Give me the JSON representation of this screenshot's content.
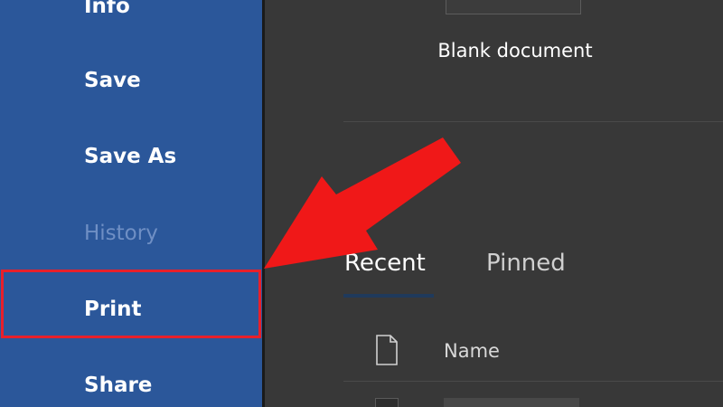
{
  "nav": {
    "items": [
      {
        "key": "info",
        "label": "Info"
      },
      {
        "key": "save",
        "label": "Save"
      },
      {
        "key": "saveas",
        "label": "Save As"
      },
      {
        "key": "history",
        "label": "History"
      },
      {
        "key": "print",
        "label": "Print"
      },
      {
        "key": "share",
        "label": "Share"
      }
    ]
  },
  "main": {
    "template_label": "Blank document",
    "tabs": [
      {
        "key": "recent",
        "label": "Recent"
      },
      {
        "key": "pinned",
        "label": "Pinned"
      }
    ],
    "column_name": "Name"
  },
  "colors": {
    "sidebar": "#2b579a",
    "background": "#383838",
    "highlight": "#e8202a"
  }
}
